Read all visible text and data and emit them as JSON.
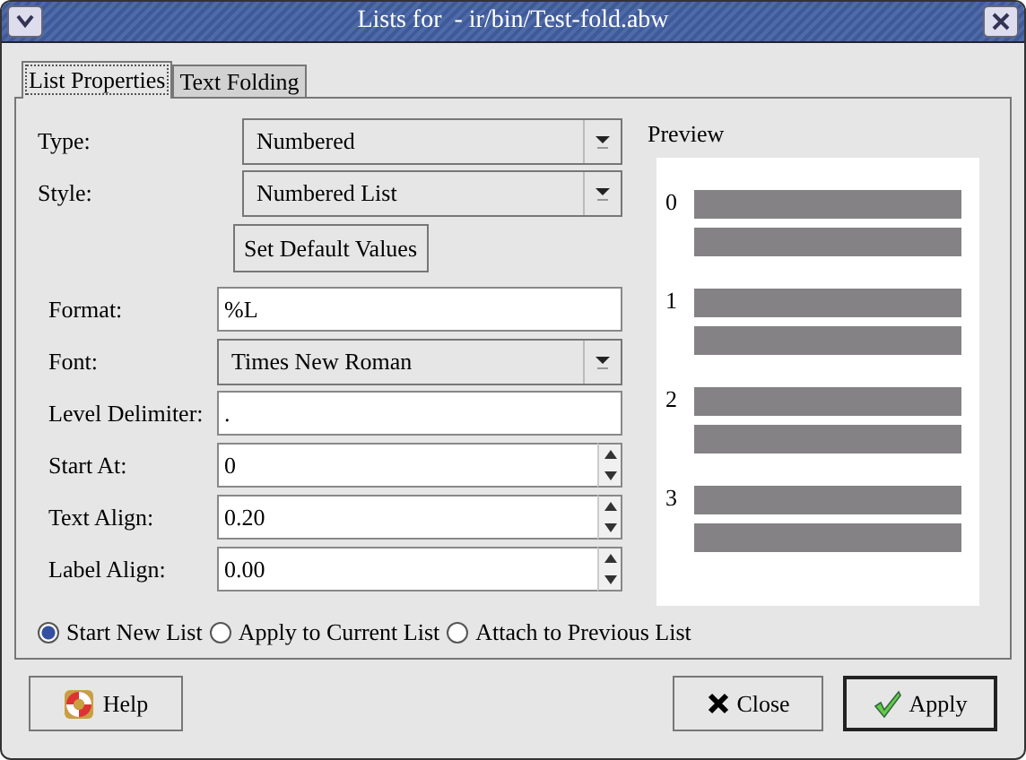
{
  "window": {
    "title": "Lists for  - ir/bin/Test-fold.abw"
  },
  "tabs": [
    {
      "label": "List Properties",
      "selected": true
    },
    {
      "label": "Text Folding",
      "selected": false
    }
  ],
  "top_fields": [
    {
      "kind": "combo",
      "label": "Type:",
      "value": "Numbered"
    },
    {
      "kind": "combo",
      "label": "Style:",
      "value": "Numbered List"
    }
  ],
  "default_button": "Set Default Values",
  "fields": [
    {
      "kind": "text",
      "label": "Format:",
      "value": "%L"
    },
    {
      "kind": "combo",
      "label": "Font:",
      "value": "Times New Roman"
    },
    {
      "kind": "text",
      "label": "Level Delimiter:",
      "value": "."
    },
    {
      "kind": "spin",
      "label": "Start At:",
      "value": "0"
    },
    {
      "kind": "spin",
      "label": "Text Align:",
      "value": "0.20"
    },
    {
      "kind": "spin",
      "label": "Label Align:",
      "value": "0.00"
    }
  ],
  "radios": [
    {
      "label": "Start New List",
      "selected": true
    },
    {
      "label": "Apply to Current List",
      "selected": false
    },
    {
      "label": "Attach to Previous List",
      "selected": false
    }
  ],
  "preview": {
    "title": "Preview",
    "numbers": [
      "0",
      "1",
      "2",
      "3"
    ]
  },
  "buttons": [
    {
      "kind": "help",
      "label": "Help"
    },
    {
      "kind": "close",
      "label": "Close"
    },
    {
      "kind": "apply",
      "label": "Apply"
    }
  ]
}
